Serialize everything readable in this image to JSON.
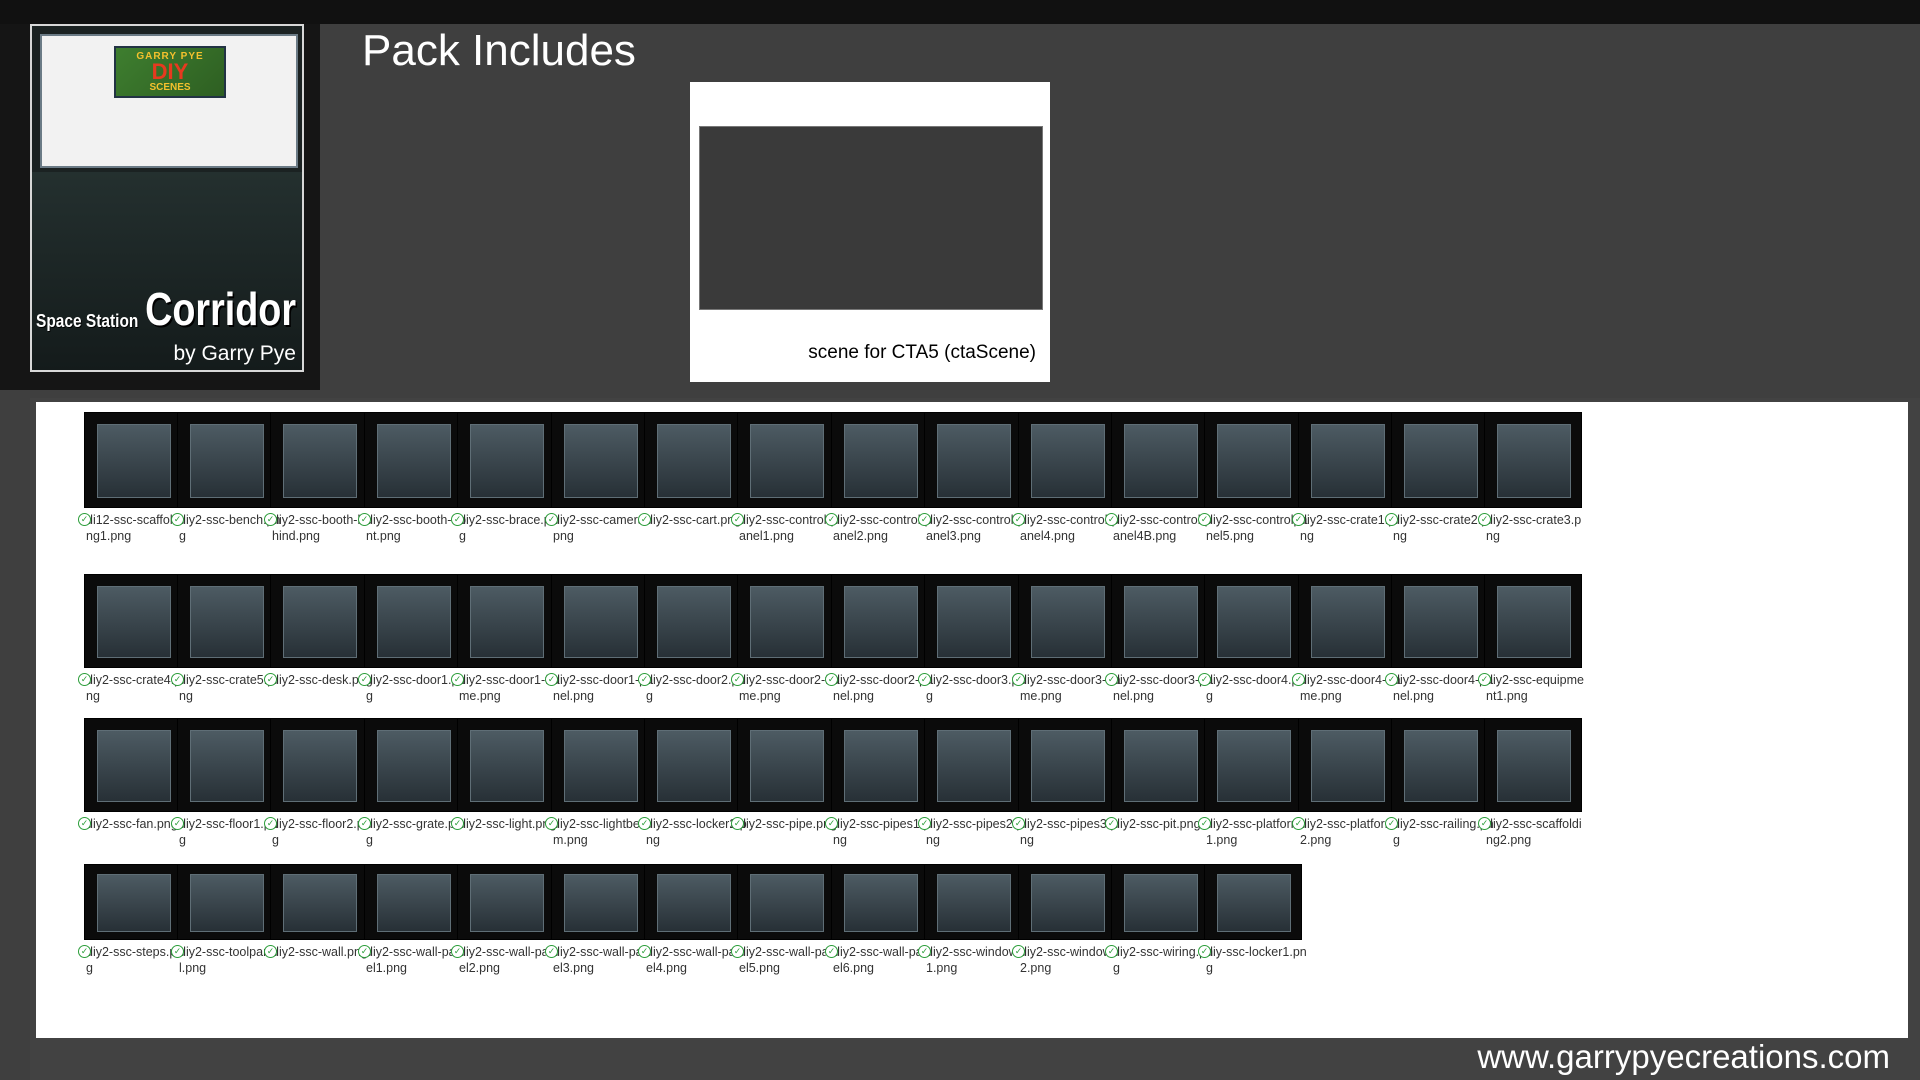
{
  "cover": {
    "badge_line1": "GARRY PYE",
    "badge_line2": "DIY",
    "badge_line3": "SCENES",
    "title": "Corridor",
    "subtitle": "Space Station",
    "author": "by Garry Pye"
  },
  "heading": "Pack Includes",
  "preview": {
    "caption": "scene for CTA5 (ctaScene)"
  },
  "files": [
    "di12-ssc-scaffolding1.png",
    "diy2-ssc-bench.png",
    "diy2-ssc-booth-behind.png",
    "diy2-ssc-booth-front.png",
    "diy2-ssc-brace.png",
    "diy2-ssc-camera.png",
    "diy2-ssc-cart.png",
    "diy2-ssc-control-panel1.png",
    "diy2-ssc-control-panel2.png",
    "diy2-ssc-control-panel3.png",
    "diy2-ssc-control-panel4.png",
    "diy2-ssc-control-panel4B.png",
    "diy2-ssc-controlpanel5.png",
    "diy2-ssc-crate1.png",
    "diy2-ssc-crate2.png",
    "diy2-ssc-crate3.png",
    "diy2-ssc-crate4.png",
    "diy2-ssc-crate5.png",
    "diy2-ssc-desk.png",
    "diy2-ssc-door1.png",
    "diy2-ssc-door1-frame.png",
    "diy2-ssc-door1-panel.png",
    "diy2-ssc-door2.png",
    "diy2-ssc-door2-frame.png",
    "diy2-ssc-door2-panel.png",
    "diy2-ssc-door3.png",
    "diy2-ssc-door3-frame.png",
    "diy2-ssc-door3-panel.png",
    "diy2-ssc-door4.png",
    "diy2-ssc-door4-frame.png",
    "diy2-ssc-door4-panel.png",
    "diy2-ssc-equipment1.png",
    "diy2-ssc-fan.png",
    "diy2-ssc-floor1.png",
    "diy2-ssc-floor2.png",
    "diy2-ssc-grate.png",
    "diy2-ssc-light.png",
    "diy2-ssc-lightbeam.png",
    "diy2-ssc-locker2.png",
    "diy2-ssc-pipe.png",
    "diy2-ssc-pipes1.png",
    "diy2-ssc-pipes2.png",
    "diy2-ssc-pipes3.png",
    "diy2-ssc-pit.png",
    "diy2-ssc-platform1.png",
    "diy2-ssc-platform2.png",
    "diy2-ssc-railing.png",
    "diy2-ssc-scaffolding2.png",
    "diy2-ssc-steps.png",
    "diy2-ssc-toolpanel.png",
    "diy2-ssc-wall.png",
    "diy2-ssc-wall-panel1.png",
    "diy2-ssc-wall-panel2.png",
    "diy2-ssc-wall-panel3.png",
    "diy2-ssc-wall-panel4.png",
    "diy2-ssc-wall-panel5.png",
    "diy2-ssc-wall-panel6.png",
    "diy2-ssc-window1.png",
    "diy2-ssc-window2.png",
    "diy2-ssc-wiring.png",
    "diy-ssc-locker1.png"
  ],
  "footer_url": "www.garrypyecreations.com"
}
